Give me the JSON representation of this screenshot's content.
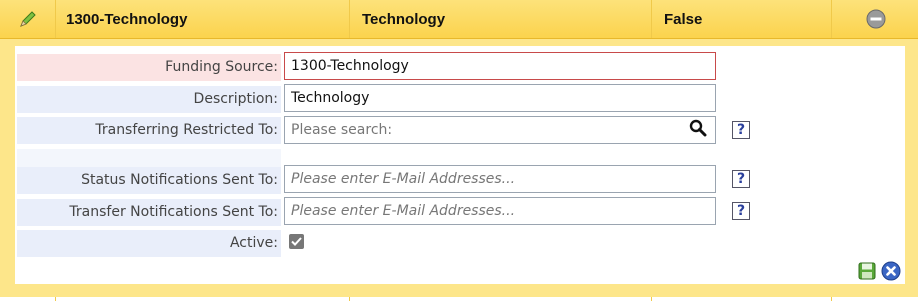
{
  "header": {
    "edit_icon": "pencil-icon",
    "col1": "1300-Technology",
    "col2": "Technology",
    "col3": "False",
    "remove_icon": "minus-circle-icon"
  },
  "form": {
    "funding_source": {
      "label": "Funding Source:",
      "value": "1300-Technology"
    },
    "description": {
      "label": "Description:",
      "value": "Technology"
    },
    "transferring_restricted": {
      "label": "Transferring Restricted To:",
      "placeholder": "Please search:"
    },
    "status_notifications": {
      "label": "Status Notifications Sent To:",
      "placeholder": "Please enter E-Mail Addresses..."
    },
    "transfer_notifications": {
      "label": "Transfer Notifications Sent To:",
      "placeholder": "Please enter E-Mail Addresses..."
    },
    "active": {
      "label": "Active:",
      "checked": true
    }
  },
  "help_label": "?",
  "colors": {
    "header_bg": "#fbd34d",
    "frame_bg": "#fde68a",
    "label_bg": "#e9eefa",
    "required_bg": "#fbe3e3"
  }
}
